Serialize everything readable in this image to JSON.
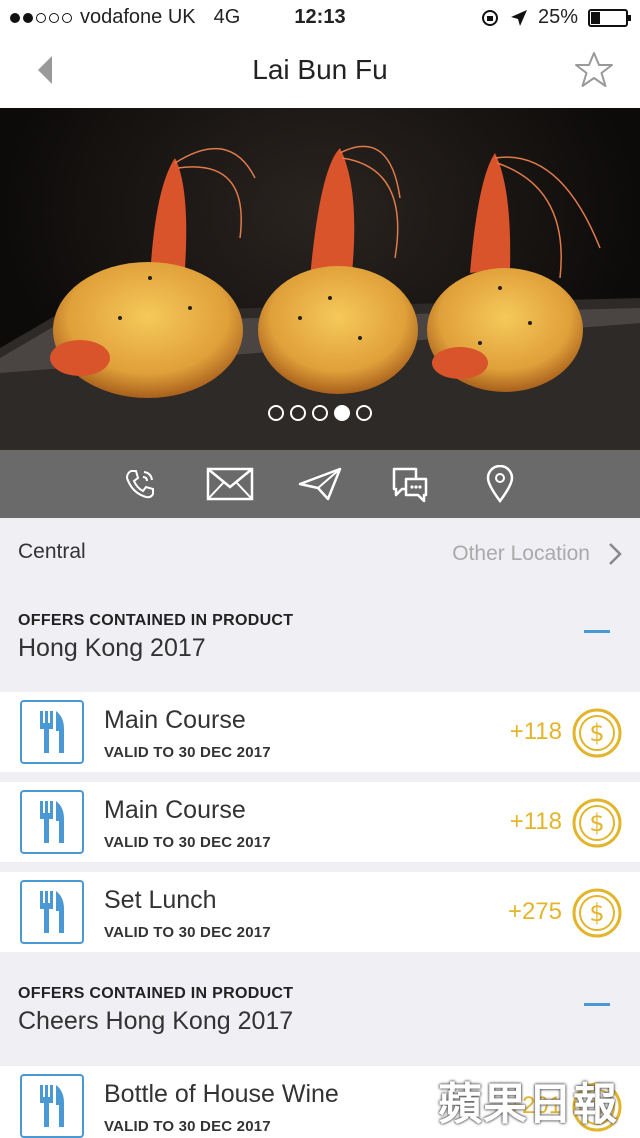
{
  "status": {
    "carrier": "vodafone UK",
    "network": "4G",
    "time": "12:13",
    "battery": "25%",
    "battery_level": 0.25,
    "signal_bars": 2,
    "signal_total": 5
  },
  "nav": {
    "title": "Lai Bun Fu"
  },
  "gallery": {
    "pages": 5,
    "active_index": 3
  },
  "actions": [
    {
      "icon": "phone-icon"
    },
    {
      "icon": "mail-icon"
    },
    {
      "icon": "send-icon"
    },
    {
      "icon": "chat-icon"
    },
    {
      "icon": "map-pin-icon"
    }
  ],
  "location": {
    "current": "Central",
    "other_label": "Other Location"
  },
  "sections": [
    {
      "caption": "OFFERS CONTAINED IN PRODUCT",
      "name": "Hong Kong 2017",
      "offers": [
        {
          "name": "Main Course",
          "valid": "VALID TO 30 DEC 2017",
          "points": "+118"
        },
        {
          "name": "Main Course",
          "valid": "VALID TO 30 DEC 2017",
          "points": "+118"
        },
        {
          "name": "Set Lunch",
          "valid": "VALID TO 30 DEC 2017",
          "points": "+275"
        }
      ]
    },
    {
      "caption": "OFFERS CONTAINED IN PRODUCT",
      "name": "Cheers Hong Kong 2017",
      "offers": [
        {
          "name": "Bottle of House Wine",
          "valid": "VALID TO 30 DEC 2017",
          "points": "+201"
        }
      ]
    }
  ],
  "colors": {
    "accent_blue": "#4a98d4",
    "coin_gold": "#e3b52c",
    "action_bar": "#6a6a6a"
  },
  "watermark": "蘋果日報"
}
